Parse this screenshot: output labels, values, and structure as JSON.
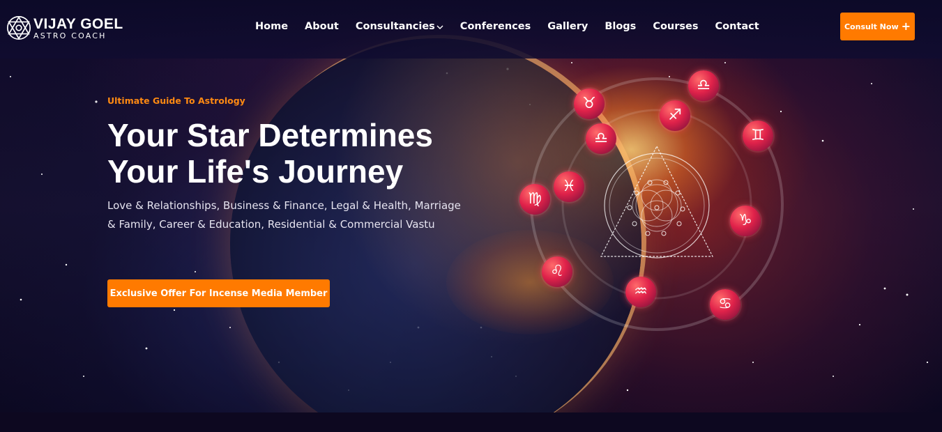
{
  "brand": {
    "name": "VIJAY GOEL",
    "tagline": "ASTRO COACH"
  },
  "nav": {
    "items": [
      {
        "label": "Home"
      },
      {
        "label": "About"
      },
      {
        "label": "Consultancies",
        "has_dropdown": true
      },
      {
        "label": "Conferences"
      },
      {
        "label": "Gallery"
      },
      {
        "label": "Blogs"
      },
      {
        "label": "Courses"
      },
      {
        "label": "Contact"
      }
    ],
    "cta_label": "Consult Now"
  },
  "hero": {
    "eyebrow": "Ultimate Guide To Astrology",
    "headline_line1": "Your Star Determines",
    "headline_line2": "Your Life's Journey",
    "description": "Love & Relationships, Business & Finance, Legal & Health, Marriage & Family, Career & Education, Residential & Commercial Vastu",
    "button_label": "Exclusive Offer For Incense Media Member"
  },
  "zodiac": {
    "taurus": "♉",
    "libra": "♎",
    "sagittarius": "♐",
    "gemini": "♊",
    "pisces": "♓",
    "virgo": "♍",
    "capricorn": "♑",
    "leo": "♌",
    "aquarius": "♒",
    "cancer": "♋"
  },
  "colors": {
    "accent": "#ff7a00",
    "eyebrow": "#ff8a12",
    "background": "#0d0820",
    "zodiac_badge": "#e0224a"
  },
  "icons": {
    "logo": "sacred-geometry-star-icon",
    "dropdown": "chevron-down-icon",
    "plus": "plus-icon"
  }
}
